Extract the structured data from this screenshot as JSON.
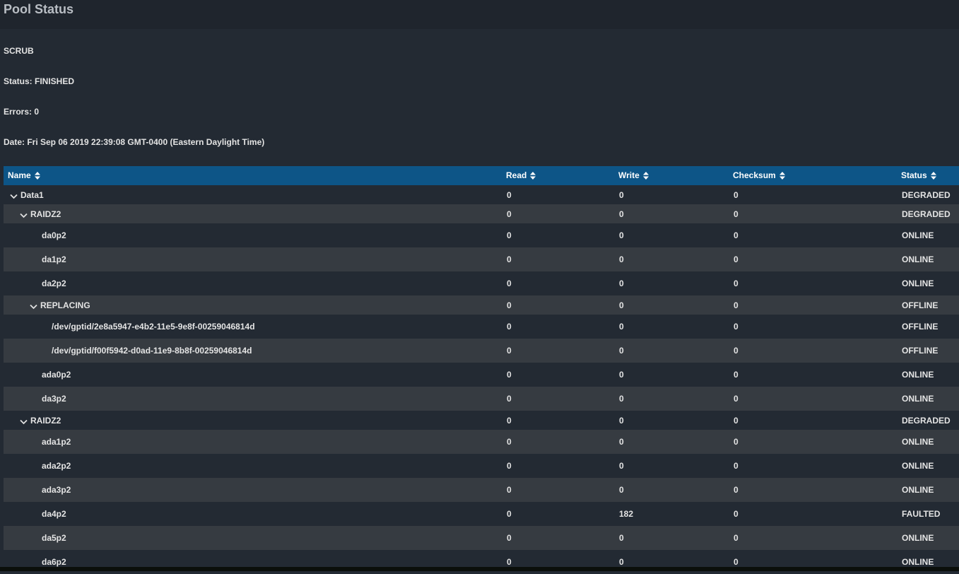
{
  "page": {
    "title": "Pool Status"
  },
  "scrub": {
    "label": "SCRUB",
    "status": "Status: FINISHED",
    "errors": "Errors: 0",
    "date": "Date: Fri Sep 06 2019 22:39:08 GMT-0400 (Eastern Daylight Time)"
  },
  "table": {
    "columns": [
      "Name",
      "Read",
      "Write",
      "Checksum",
      "Status"
    ],
    "rows": [
      {
        "name": "Data1",
        "level": 0,
        "expandable": true,
        "read": "0",
        "write": "0",
        "checksum": "0",
        "status": "DEGRADED"
      },
      {
        "name": "RAIDZ2",
        "level": 1,
        "expandable": true,
        "read": "0",
        "write": "0",
        "checksum": "0",
        "status": "DEGRADED"
      },
      {
        "name": "da0p2",
        "level": 2,
        "expandable": false,
        "read": "0",
        "write": "0",
        "checksum": "0",
        "status": "ONLINE"
      },
      {
        "name": "da1p2",
        "level": 2,
        "expandable": false,
        "read": "0",
        "write": "0",
        "checksum": "0",
        "status": "ONLINE"
      },
      {
        "name": "da2p2",
        "level": 2,
        "expandable": false,
        "read": "0",
        "write": "0",
        "checksum": "0",
        "status": "ONLINE"
      },
      {
        "name": "REPLACING",
        "level": 2,
        "expandable": true,
        "read": "0",
        "write": "0",
        "checksum": "0",
        "status": "OFFLINE"
      },
      {
        "name": "/dev/gptid/2e8a5947-e4b2-11e5-9e8f-00259046814d",
        "level": 3,
        "expandable": false,
        "read": "0",
        "write": "0",
        "checksum": "0",
        "status": "OFFLINE"
      },
      {
        "name": "/dev/gptid/f00f5942-d0ad-11e9-8b8f-00259046814d",
        "level": 3,
        "expandable": false,
        "read": "0",
        "write": "0",
        "checksum": "0",
        "status": "OFFLINE"
      },
      {
        "name": "ada0p2",
        "level": 2,
        "expandable": false,
        "read": "0",
        "write": "0",
        "checksum": "0",
        "status": "ONLINE"
      },
      {
        "name": "da3p2",
        "level": 2,
        "expandable": false,
        "read": "0",
        "write": "0",
        "checksum": "0",
        "status": "ONLINE"
      },
      {
        "name": "RAIDZ2",
        "level": 1,
        "expandable": true,
        "read": "0",
        "write": "0",
        "checksum": "0",
        "status": "DEGRADED"
      },
      {
        "name": "ada1p2",
        "level": 2,
        "expandable": false,
        "read": "0",
        "write": "0",
        "checksum": "0",
        "status": "ONLINE"
      },
      {
        "name": "ada2p2",
        "level": 2,
        "expandable": false,
        "read": "0",
        "write": "0",
        "checksum": "0",
        "status": "ONLINE"
      },
      {
        "name": "ada3p2",
        "level": 2,
        "expandable": false,
        "read": "0",
        "write": "0",
        "checksum": "0",
        "status": "ONLINE"
      },
      {
        "name": "da4p2",
        "level": 2,
        "expandable": false,
        "read": "0",
        "write": "182",
        "checksum": "0",
        "status": "FAULTED"
      },
      {
        "name": "da5p2",
        "level": 2,
        "expandable": false,
        "read": "0",
        "write": "0",
        "checksum": "0",
        "status": "ONLINE"
      },
      {
        "name": "da6p2",
        "level": 2,
        "expandable": false,
        "read": "0",
        "write": "0",
        "checksum": "0",
        "status": "ONLINE"
      }
    ]
  },
  "icons": {
    "sort": "sort-icon",
    "expand": "chevron-down-icon"
  },
  "colors": {
    "header": "#0d5587",
    "background": "#232a33",
    "stripe": "#363b41"
  }
}
